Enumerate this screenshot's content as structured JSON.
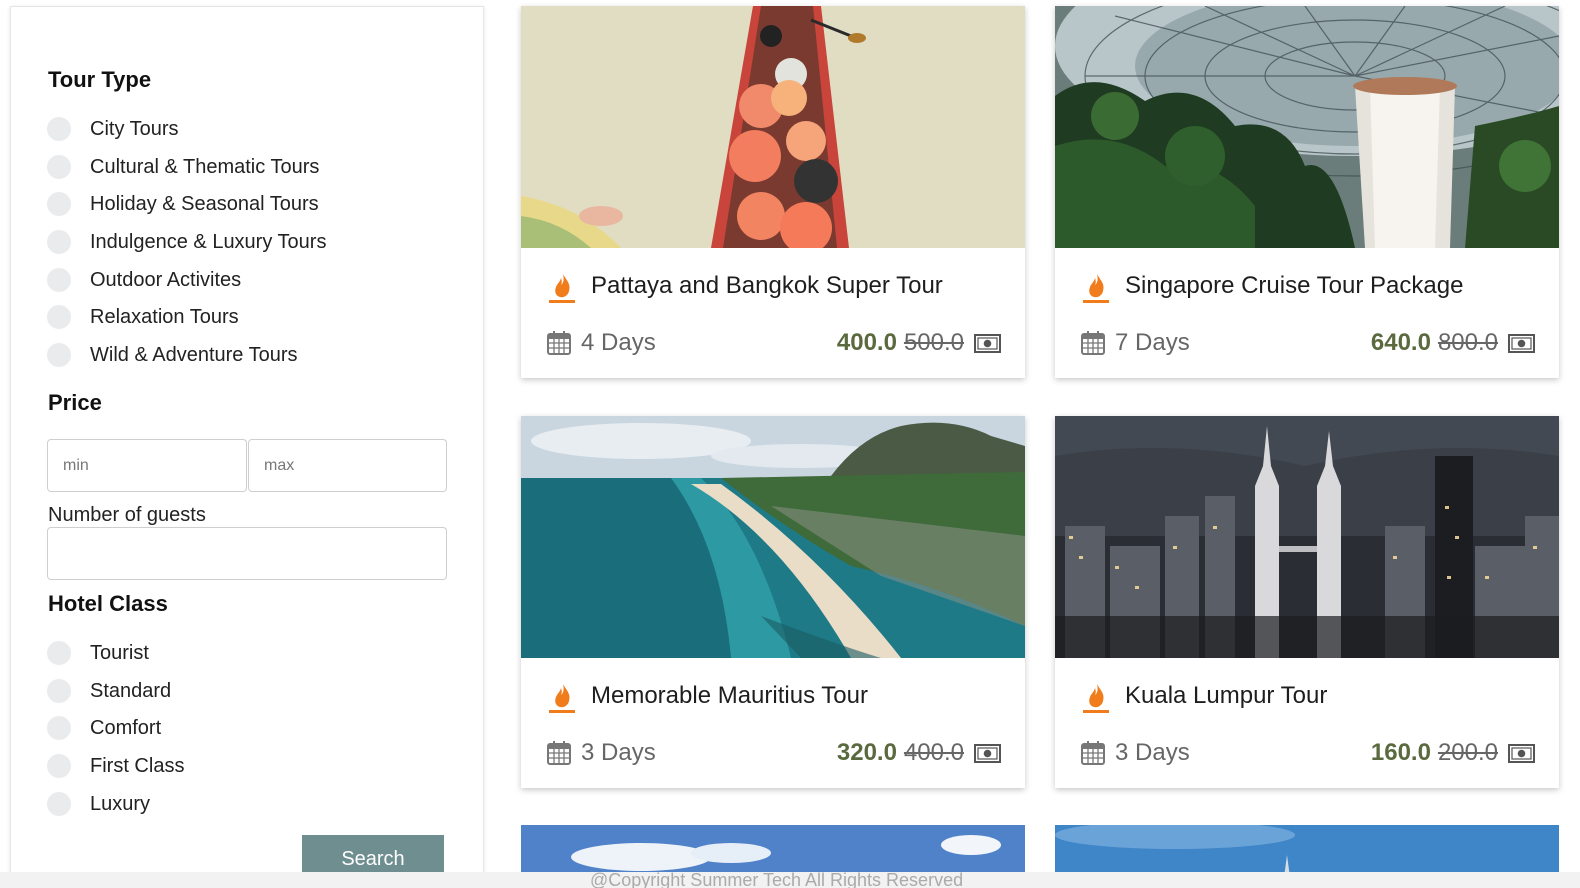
{
  "filters": {
    "tour_type_title": "Tour Type",
    "tour_types": [
      {
        "label": "City Tours"
      },
      {
        "label": "Cultural & Thematic Tours"
      },
      {
        "label": "Holiday & Seasonal Tours"
      },
      {
        "label": "Indulgence & Luxury Tours"
      },
      {
        "label": "Outdoor Activites"
      },
      {
        "label": "Relaxation Tours"
      },
      {
        "label": "Wild & Adventure Tours"
      }
    ],
    "price_title": "Price",
    "price_min_placeholder": "min",
    "price_max_placeholder": "max",
    "guests_label": "Number of guests",
    "guests_value": "",
    "hotel_class_title": "Hotel Class",
    "hotel_classes": [
      {
        "label": "Tourist"
      },
      {
        "label": "Standard"
      },
      {
        "label": "Comfort"
      },
      {
        "label": "First Class"
      },
      {
        "label": "Luxury"
      }
    ],
    "search_label": "Search"
  },
  "tours": [
    {
      "title": "Pattaya and Bangkok Super Tour",
      "duration": "4 Days",
      "price": "400.0",
      "old_price": "500.0",
      "image": "boat-photo"
    },
    {
      "title": "Singapore Cruise Tour Package",
      "duration": "7 Days",
      "price": "640.0",
      "old_price": "800.0",
      "image": "waterfall-dome-photo"
    },
    {
      "title": "Memorable Mauritius Tour",
      "duration": "3 Days",
      "price": "320.0",
      "old_price": "400.0",
      "image": "beach-photo"
    },
    {
      "title": "Kuala Lumpur Tour",
      "duration": "3 Days",
      "price": "160.0",
      "old_price": "200.0",
      "image": "city-night-photo"
    }
  ],
  "footer": {
    "copyright": "@Copyright Summer Tech All Rights Reserved"
  },
  "colors": {
    "accent": "#f07c1c",
    "price": "#5a6a3e",
    "button": "#6f8e8f"
  }
}
